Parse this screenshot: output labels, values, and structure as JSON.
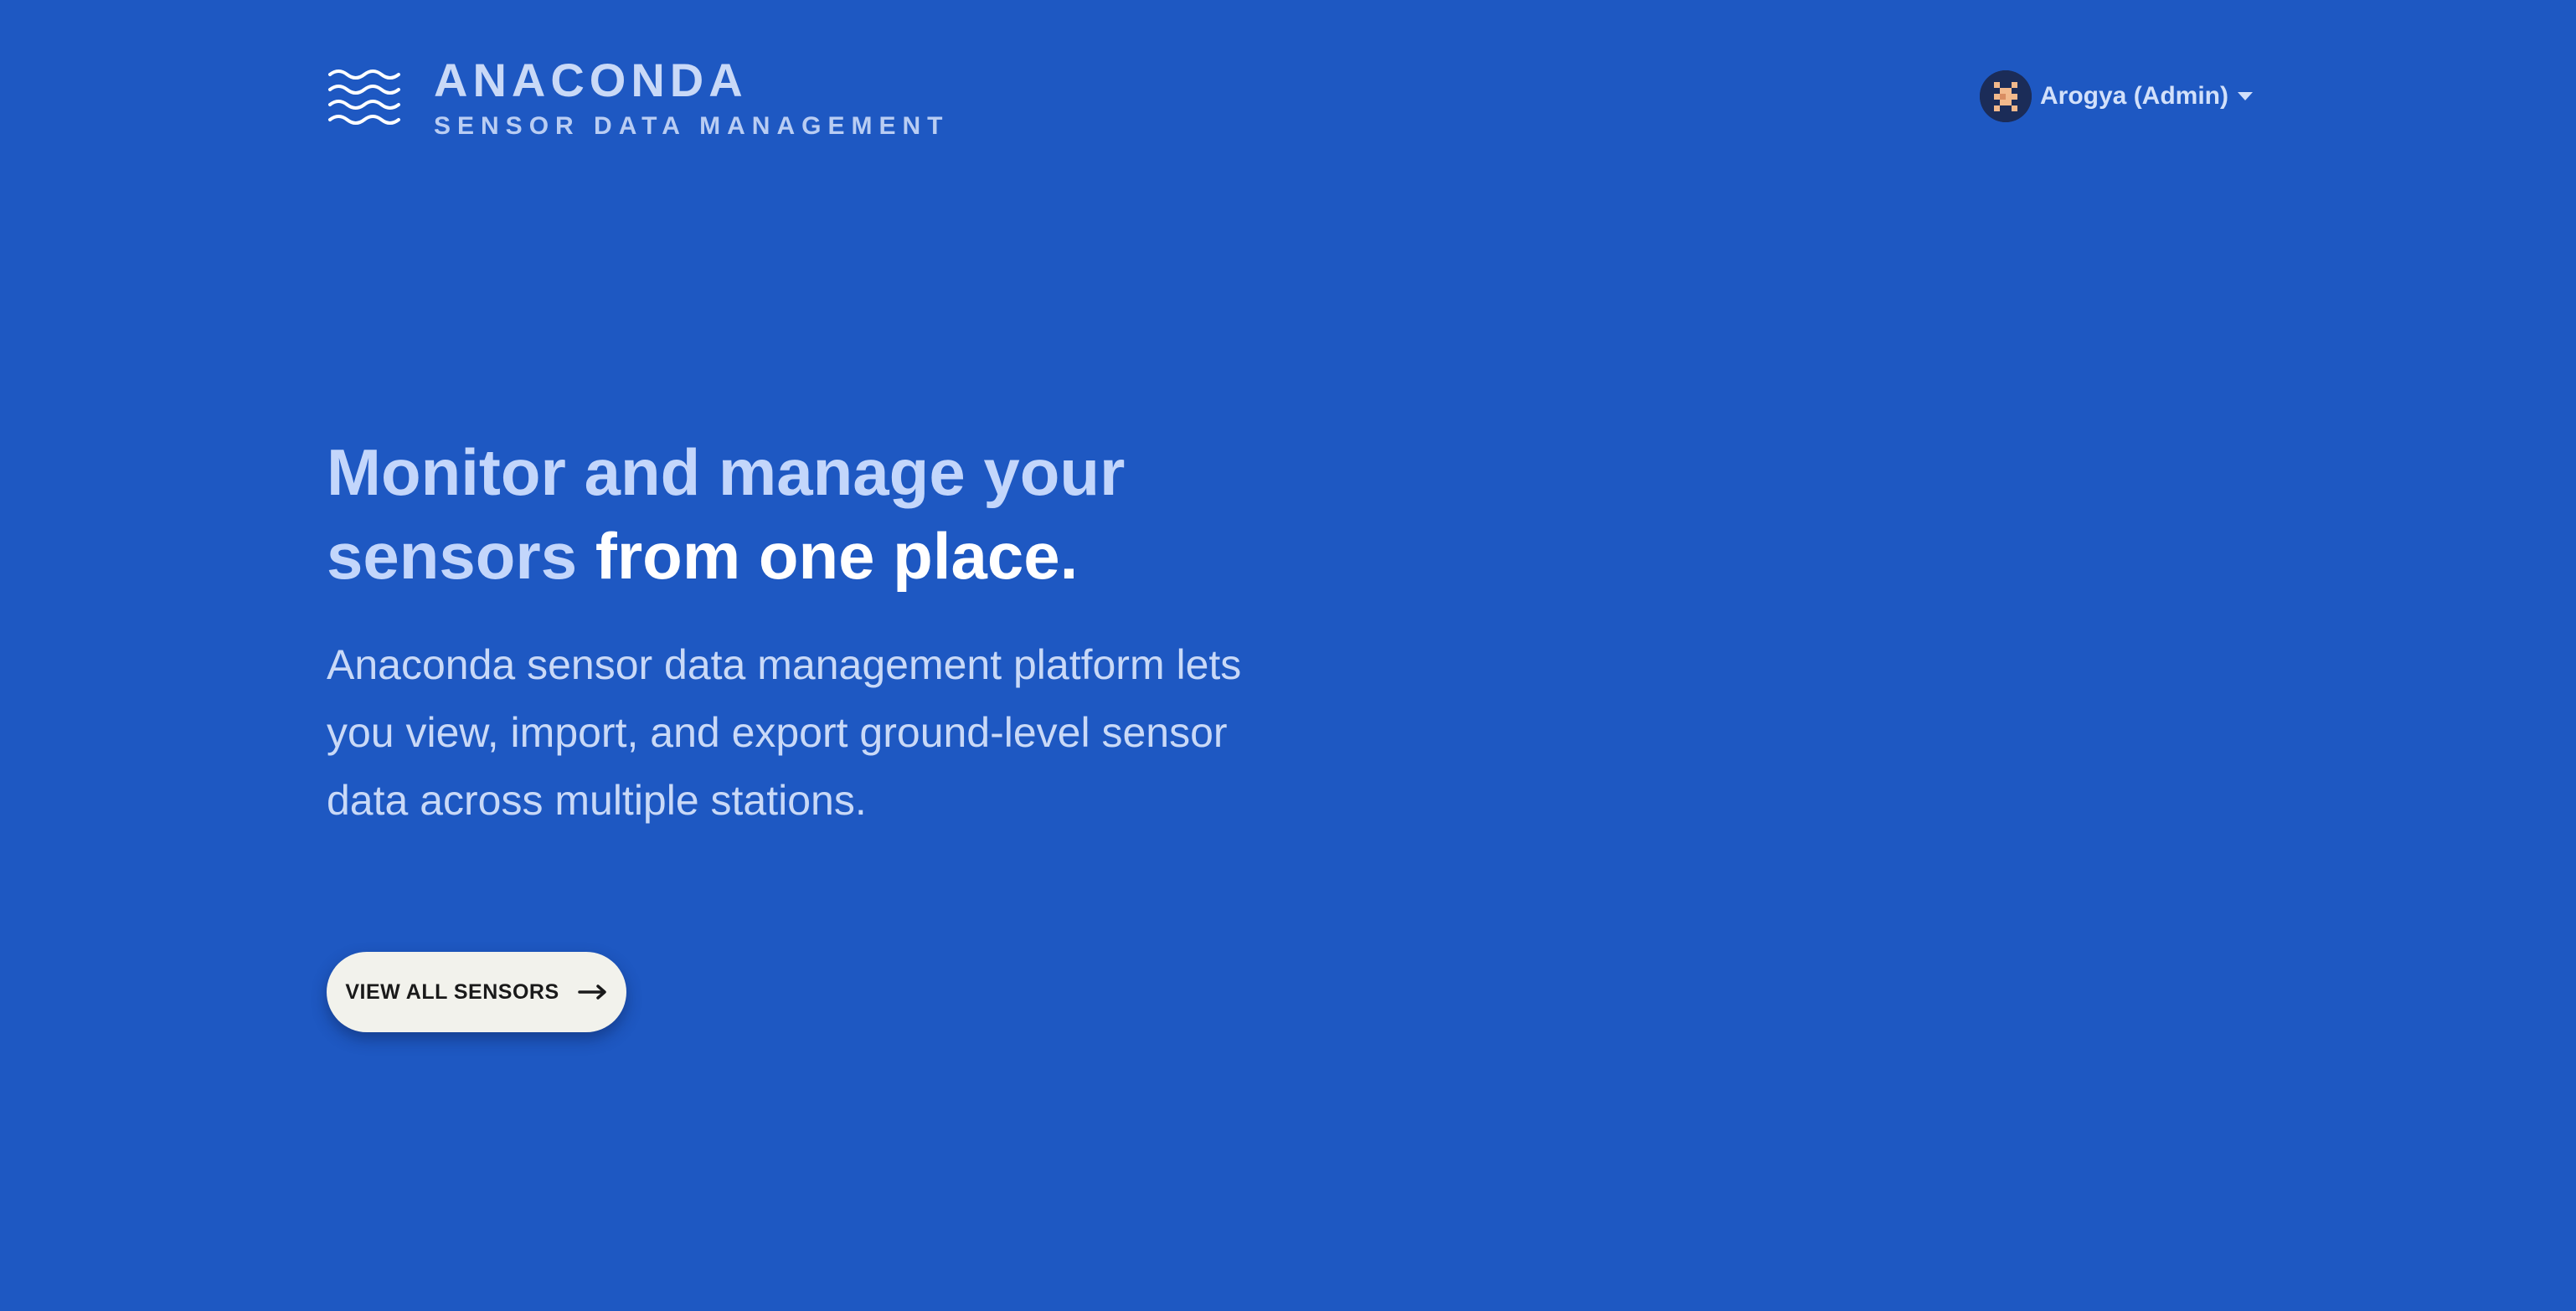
{
  "header": {
    "brand_name": "ANACONDA",
    "brand_tagline": "SENSOR DATA MANAGEMENT",
    "logo_icon": "waves-icon"
  },
  "user_menu": {
    "name": "Arogya (Admin)",
    "avatar_icon": "pixel-avatar-icon",
    "dropdown_icon": "caret-down-icon"
  },
  "hero": {
    "title_part1": "Monitor and manage your sensors",
    "title_part2": "from one place.",
    "description": "Anaconda sensor data management platform lets you view, import, and export ground-level sensor data across multiple stations."
  },
  "cta": {
    "label": "VIEW ALL SENSORS",
    "icon": "arrow-right-icon"
  },
  "colors": {
    "background": "#1e58c2",
    "title_muted": "#c3d6fb",
    "title_strong": "#ffffff",
    "button_bg": "#f2f2ec"
  }
}
